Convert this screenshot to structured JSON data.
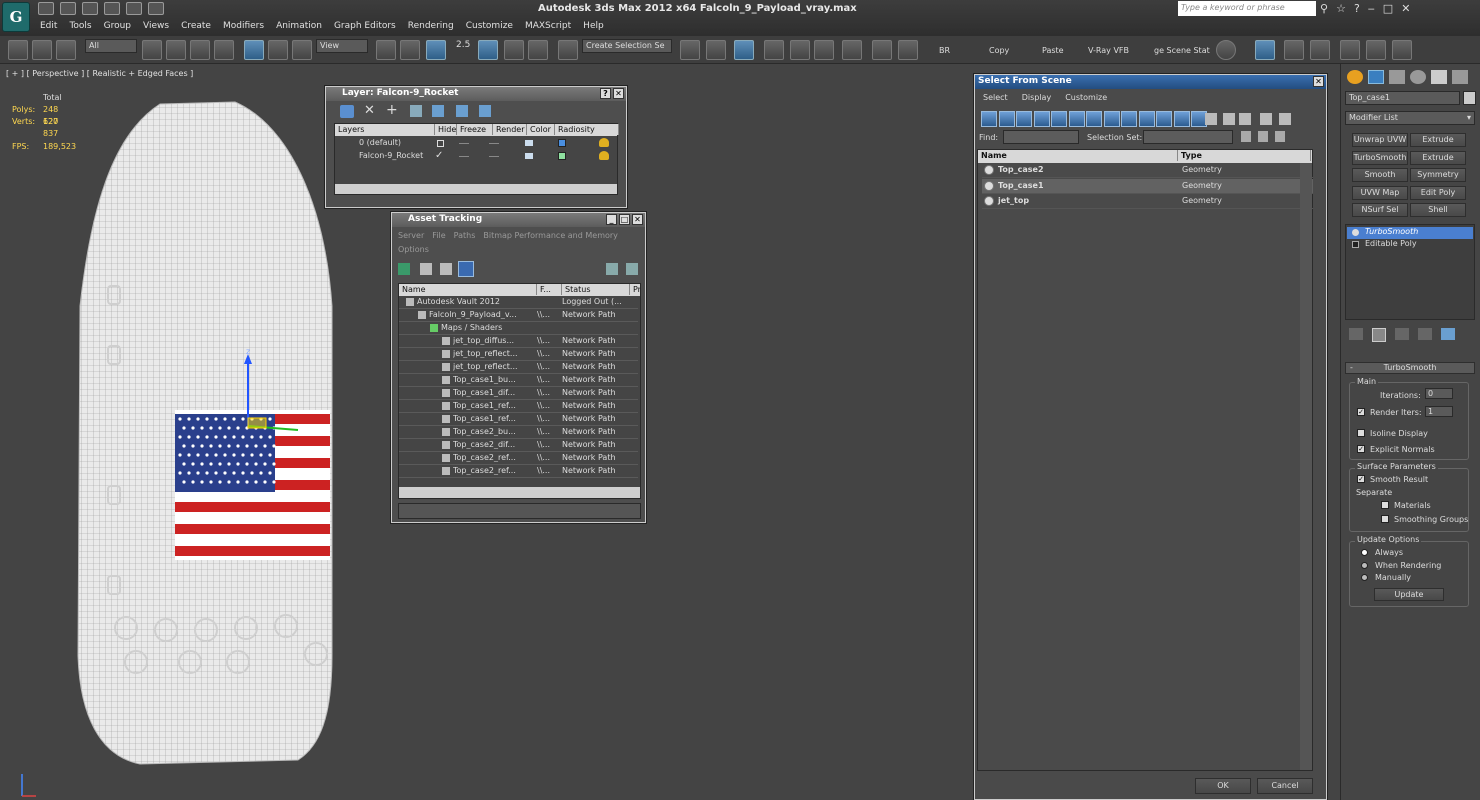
{
  "app": {
    "title": "Autodesk 3ds Max  2012 x64    Falcoln_9_Payload_vray.max",
    "logo": "G",
    "search_placeholder": "Type a keyword or phrase",
    "menus": [
      "Edit",
      "Tools",
      "Group",
      "Views",
      "Create",
      "Modifiers",
      "Animation",
      "Graph Editors",
      "Rendering",
      "Customize",
      "MAXScript",
      "Help"
    ]
  },
  "toolbar": {
    "filter": "All",
    "refcoord": "View",
    "snap_value": "2.5",
    "selection_set": "Create Selection Se",
    "labels": [
      "BR",
      "Copy",
      "Paste",
      "V-Ray VFB",
      "ge Scene Stat"
    ]
  },
  "viewport": {
    "label": "[ + ] [ Perspective ] [ Realistic + Edged Faces ]",
    "stats": {
      "header": "Total",
      "polys_label": "Polys:",
      "polys": "248 620",
      "verts_label": "Verts:",
      "verts": "127 837",
      "fps_label": "FPS:",
      "fps": "189,523"
    },
    "gizmo_axis": "z"
  },
  "layer_window": {
    "title": "Layer: Falcon-9_Rocket",
    "columns": [
      "Layers",
      "Hide",
      "Freeze",
      "Render",
      "Color",
      "Radiosity"
    ],
    "rows": [
      {
        "name": "0 (default)",
        "color": "#4a8fe0"
      },
      {
        "name": "Falcon-9_Rocket",
        "color": "#8fe0a0"
      }
    ]
  },
  "asset_window": {
    "title": "Asset Tracking",
    "menus": [
      "Server",
      "File",
      "Paths",
      "Bitmap Performance and Memory"
    ],
    "menus2": [
      "Options"
    ],
    "columns": [
      "Name",
      "F...",
      "Status",
      "Pr"
    ],
    "rows": [
      {
        "name": "Autodesk Vault 2012",
        "f": "",
        "status": "Logged Out (...",
        "indent": 1
      },
      {
        "name": "Falcoln_9_Payload_v...",
        "f": "\\\\...",
        "status": "Network Path",
        "indent": 2
      },
      {
        "name": "Maps / Shaders",
        "f": "",
        "status": "",
        "indent": 3
      },
      {
        "name": "jet_top_diffus...",
        "f": "\\\\...",
        "status": "Network Path",
        "indent": 4
      },
      {
        "name": "jet_top_reflect...",
        "f": "\\\\...",
        "status": "Network Path",
        "indent": 4
      },
      {
        "name": "jet_top_reflect...",
        "f": "\\\\...",
        "status": "Network Path",
        "indent": 4
      },
      {
        "name": "Top_case1_bu...",
        "f": "\\\\...",
        "status": "Network Path",
        "indent": 4
      },
      {
        "name": "Top_case1_dif...",
        "f": "\\\\...",
        "status": "Network Path",
        "indent": 4
      },
      {
        "name": "Top_case1_ref...",
        "f": "\\\\...",
        "status": "Network Path",
        "indent": 4
      },
      {
        "name": "Top_case1_ref...",
        "f": "\\\\...",
        "status": "Network Path",
        "indent": 4
      },
      {
        "name": "Top_case2_bu...",
        "f": "\\\\...",
        "status": "Network Path",
        "indent": 4
      },
      {
        "name": "Top_case2_dif...",
        "f": "\\\\...",
        "status": "Network Path",
        "indent": 4
      },
      {
        "name": "Top_case2_ref...",
        "f": "\\\\...",
        "status": "Network Path",
        "indent": 4
      },
      {
        "name": "Top_case2_ref...",
        "f": "\\\\...",
        "status": "Network Path",
        "indent": 4
      }
    ]
  },
  "select_from_scene": {
    "title": "Select From Scene",
    "menus": [
      "Select",
      "Display",
      "Customize"
    ],
    "find_label": "Find:",
    "find_value": "",
    "selection_set_label": "Selection Set:",
    "selection_set_value": "",
    "columns": [
      "Name",
      "Type"
    ],
    "rows": [
      {
        "name": "Top_case2",
        "type": "Geometry",
        "selected": false
      },
      {
        "name": "Top_case1",
        "type": "Geometry",
        "selected": true
      },
      {
        "name": "jet_top",
        "type": "Geometry",
        "selected": false
      }
    ],
    "ok": "OK",
    "cancel": "Cancel"
  },
  "command_panel": {
    "object_name": "Top_case1",
    "modifier_list": "Modifier List",
    "modifier_buttons": [
      "Unwrap UVW",
      "Extrude",
      "TurboSmooth",
      "Extrude",
      "Smooth",
      "Symmetry",
      "UVW Map",
      "Edit Poly",
      "NSurf Sel",
      "Shell"
    ],
    "stack": [
      {
        "name": "TurboSmooth",
        "active": true
      },
      {
        "name": "Editable Poly",
        "active": false
      }
    ],
    "rollout": {
      "title": "TurboSmooth",
      "collapse": "-",
      "main_label": "Main",
      "iterations_label": "Iterations:",
      "iterations": "0",
      "render_iters_label": "Render Iters:",
      "render_iters": "1",
      "render_iters_checked": true,
      "isoline_label": "Isoline Display",
      "isoline_checked": false,
      "explicit_label": "Explicit Normals",
      "explicit_checked": true,
      "surface_label": "Surface Parameters",
      "smooth_result_label": "Smooth Result",
      "smooth_result_checked": true,
      "separate_label": "Separate",
      "materials_label": "Materials",
      "smoothing_groups_label": "Smoothing Groups",
      "update_options_label": "Update Options",
      "update_radios": [
        "Always",
        "When Rendering",
        "Manually"
      ],
      "update_selected": "Always",
      "update_button": "Update"
    }
  }
}
